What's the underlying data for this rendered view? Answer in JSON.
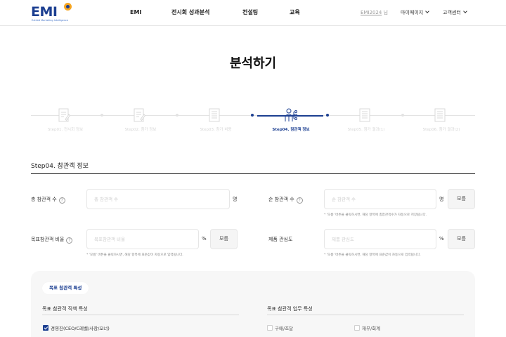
{
  "header": {
    "logo_text": "EMI",
    "logo_tagline": "Exhibit Marketing Intelligence",
    "nav": [
      "EMI",
      "전시회 성과분석",
      "컨설팅",
      "교육"
    ],
    "user_name": "EMI2024",
    "user_suffix": " 님",
    "mypage": "마이페이지",
    "support": "고객센터"
  },
  "page_title": "분석하기",
  "steps": [
    {
      "label": "Step01. 전시회 정보",
      "icon": "document-edit-icon",
      "active": false
    },
    {
      "label": "Step02. 참가 정보",
      "icon": "document-edit-icon",
      "active": false
    },
    {
      "label": "Step03. 참가 비용",
      "icon": "document-list-icon",
      "active": false
    },
    {
      "label": "Step04. 참관객 정보",
      "icon": "people-network-icon",
      "active": true
    },
    {
      "label": "Step05. 참가 결과(1)",
      "icon": "document-list-icon",
      "active": false
    },
    {
      "label": "Step06. 참가 결과(2)",
      "icon": "document-list-icon",
      "active": false
    }
  ],
  "section_title": "Step04. 참관객 정보",
  "form": {
    "total_visitors": {
      "label": "총 참관객 수",
      "placeholder": "총 참관객 수",
      "unit": "명"
    },
    "net_visitors": {
      "label": "순 참관객 수",
      "placeholder": "순 참관객 수",
      "unit": "명",
      "button": "모름",
      "hint": "* '모름' 버튼을 클릭하시면, 해당 항목에 총참관객수가 자동으로 저장됩니다."
    },
    "target_ratio": {
      "label": "목표참관객 비율",
      "placeholder": "목표참관객 비율",
      "unit": "%",
      "button": "모름",
      "hint": "* '모름' 버튼을 클릭하시면, 해당 항목에 표준값이 자동으로 입력됩니다."
    },
    "product_interest": {
      "label": "제품 관심도",
      "placeholder": "제품 관심도",
      "unit": "%",
      "button": "모름",
      "hint": "* '모름' 버튼을 클릭하시면, 해당 항목에 표준값이 자동으로 입력됩니다."
    }
  },
  "characteristics": {
    "chip": "목표 참관객 특성",
    "position_title": "목표 참관객 직책 특성",
    "position_items": [
      {
        "label": "경영진(CEO/C레벨/사장/오너)",
        "checked": true
      }
    ],
    "task_title": "목표 참관객 업무 특성",
    "task_items": [
      {
        "label": "구매/조달",
        "checked": false
      },
      {
        "label": "재무/회계",
        "checked": false
      }
    ]
  },
  "colors": {
    "brand": "#1c3f91",
    "accent": "#f6a623",
    "panel_bg": "#f7f7f7"
  }
}
